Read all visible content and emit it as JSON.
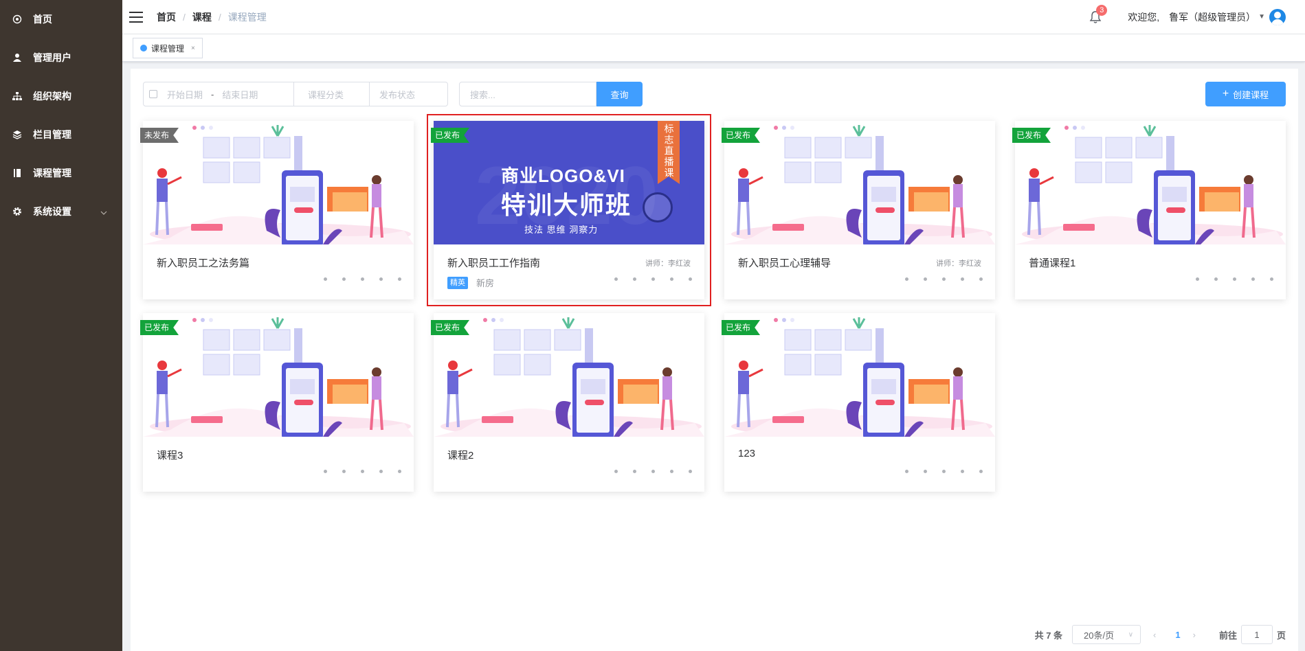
{
  "sidebar": {
    "items": [
      {
        "label": "首页",
        "icon": "dashboard-icon"
      },
      {
        "label": "管理用户",
        "icon": "user-icon"
      },
      {
        "label": "组织架构",
        "icon": "org-tree-icon"
      },
      {
        "label": "栏目管理",
        "icon": "layers-icon"
      },
      {
        "label": "课程管理",
        "icon": "book-icon"
      },
      {
        "label": "系统设置",
        "icon": "gear-icon",
        "has_submenu": true
      }
    ],
    "background": "#3e362f"
  },
  "header": {
    "breadcrumb": [
      "首页",
      "课程",
      "课程管理"
    ],
    "notification_count": "3",
    "welcome": "欢迎您,",
    "username": "鲁军（超级管理员）"
  },
  "tags_view": {
    "active_tag": "课程管理",
    "close_symbol": "×"
  },
  "filters": {
    "start_date_placeholder": "开始日期",
    "range_separator": "-",
    "end_date_placeholder": "结束日期",
    "category_placeholder": "课程分类",
    "status_placeholder": "发布状态",
    "search_placeholder": "搜索...",
    "search_button": "查询",
    "create_button": "创建课程"
  },
  "courses": [
    {
      "title": "新入职员工之法务篇",
      "status": "未发布",
      "teacher": "",
      "tags": []
    },
    {
      "title": "新入职员工工作指南",
      "status": "已发布",
      "teacher": "讲师：李红波",
      "tags": [
        "精英",
        "新房"
      ],
      "banner": {
        "line1": "商业LOGO&VI",
        "line2": "特训大师班",
        "line3": "技法  思维  洞察力",
        "ribbon": "标志直播课",
        "ghost": "2020"
      }
    },
    {
      "title": "新入职员工心理辅导",
      "status": "已发布",
      "teacher": "讲师：李红波",
      "tags": []
    },
    {
      "title": "普通课程1",
      "status": "已发布",
      "teacher": "",
      "tags": []
    },
    {
      "title": "课程3",
      "status": "已发布",
      "teacher": "",
      "tags": []
    },
    {
      "title": "课程2",
      "status": "已发布",
      "teacher": "",
      "tags": []
    },
    {
      "title": "123",
      "status": "已发布",
      "teacher": "",
      "tags": []
    }
  ],
  "pagination": {
    "total": "共 7 条",
    "page_size": "20条/页",
    "current_page": "1",
    "goto_label": "前往",
    "goto_value": "1",
    "page_word": "页"
  },
  "colors": {
    "primary": "#409eff",
    "published": "#13a33b",
    "unpublished": "#6d6d6d",
    "highlight_frame": "#e02020"
  }
}
